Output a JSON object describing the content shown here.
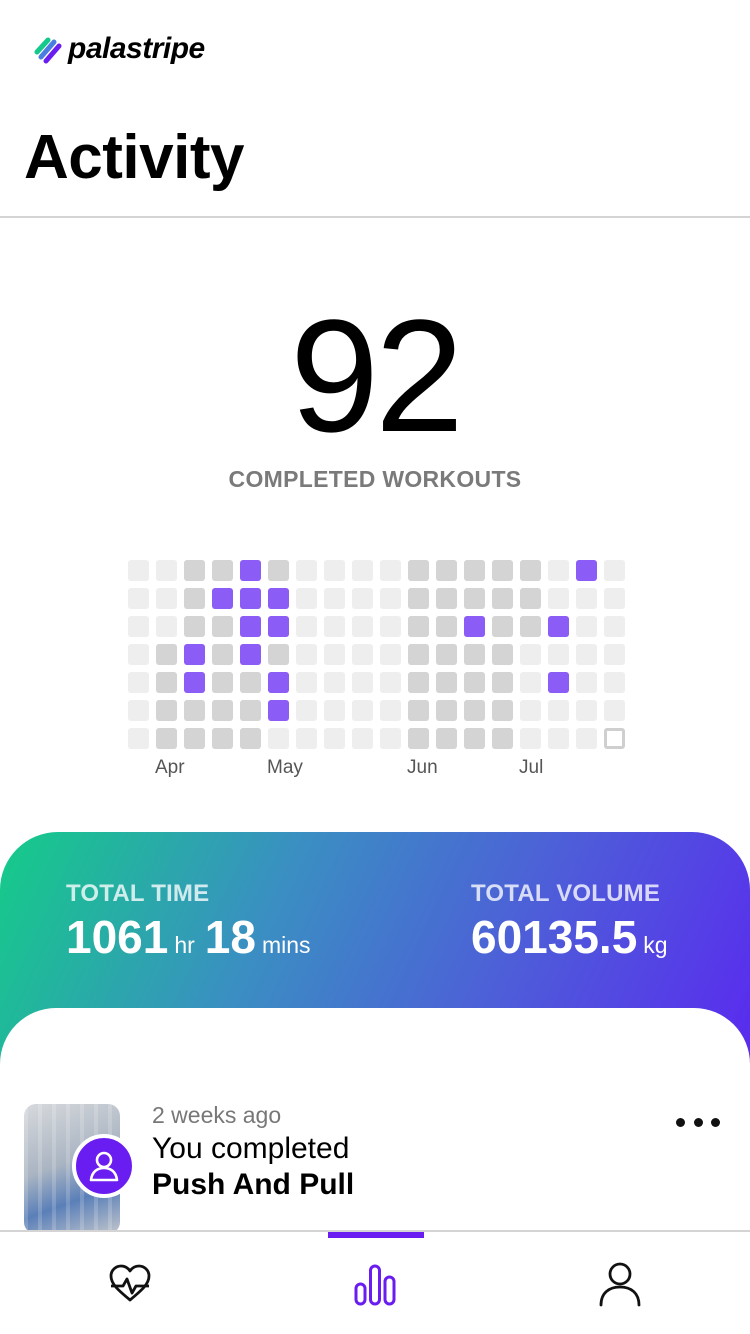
{
  "app": {
    "brand": "palastripe",
    "page_title": "Activity"
  },
  "summary": {
    "completed_count": "92",
    "completed_label": "COMPLETED WORKOUTS"
  },
  "heatmap": {
    "months": [
      "Apr",
      "May",
      "Jun",
      "Jul"
    ],
    "levels": [
      [
        0,
        0,
        1,
        1,
        2,
        1,
        0,
        0,
        0,
        0,
        1,
        1,
        1,
        1,
        1,
        0,
        2,
        0
      ],
      [
        0,
        0,
        1,
        2,
        2,
        2,
        0,
        0,
        0,
        0,
        1,
        1,
        1,
        1,
        1,
        0,
        0,
        0
      ],
      [
        0,
        0,
        1,
        1,
        2,
        2,
        0,
        0,
        0,
        0,
        1,
        1,
        2,
        1,
        1,
        2,
        0,
        0
      ],
      [
        0,
        1,
        2,
        1,
        2,
        1,
        0,
        0,
        0,
        0,
        1,
        1,
        1,
        1,
        0,
        0,
        0,
        0
      ],
      [
        0,
        1,
        2,
        1,
        1,
        2,
        0,
        0,
        0,
        0,
        1,
        1,
        1,
        1,
        0,
        2,
        0,
        0
      ],
      [
        0,
        1,
        1,
        1,
        1,
        2,
        0,
        0,
        0,
        0,
        1,
        1,
        1,
        1,
        0,
        0,
        0,
        0
      ],
      [
        0,
        1,
        1,
        1,
        1,
        0,
        0,
        0,
        0,
        0,
        1,
        1,
        1,
        1,
        0,
        0,
        0,
        3
      ]
    ],
    "colors": {
      "empty": "#eeeeee",
      "rest": "#d4d4d4",
      "workout": "#8b5cf6",
      "today_border": "#cfcfcf"
    }
  },
  "stats": {
    "total_time_label": "TOTAL TIME",
    "hours": "1061",
    "hours_unit": "hr",
    "minutes": "18",
    "minutes_unit": "mins",
    "total_volume_label": "TOTAL VOLUME",
    "volume": "60135.5",
    "volume_unit": "kg"
  },
  "feed": [
    {
      "time": "2 weeks ago",
      "line1": "You completed",
      "line2": "Push And Pull",
      "avatar_icon": "user-icon",
      "menu_icon": "more-icon"
    }
  ],
  "tabs": [
    {
      "name": "health",
      "icon": "heart-pulse-icon",
      "active": false
    },
    {
      "name": "activity",
      "icon": "bar-chart-icon",
      "active": true
    },
    {
      "name": "profile",
      "icon": "user-icon",
      "active": false
    }
  ],
  "accent": "#6a1df0"
}
